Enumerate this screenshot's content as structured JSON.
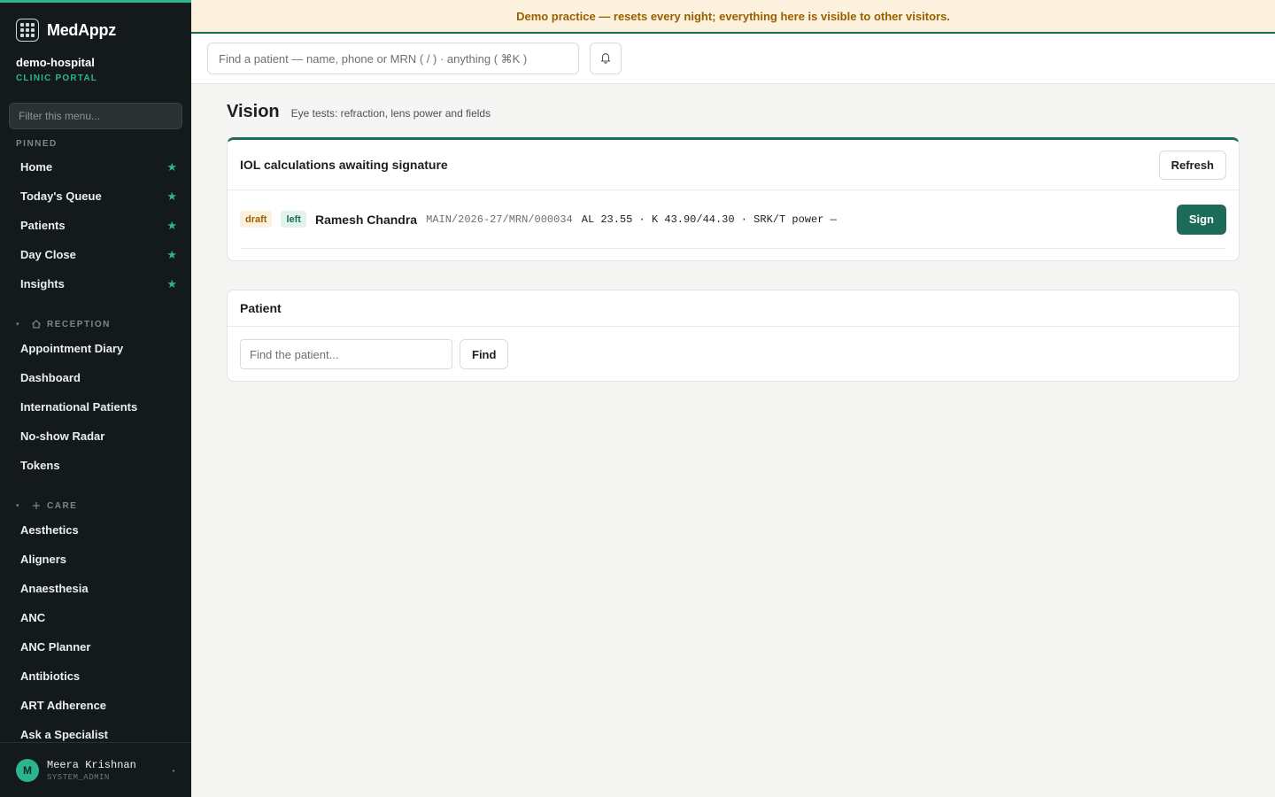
{
  "brand": {
    "name": "MedAppz"
  },
  "org": {
    "name": "demo-hospital",
    "subtitle": "CLINIC PORTAL"
  },
  "sidebar": {
    "filter_placeholder": "Filter this menu...",
    "pinned_label": "PINNED",
    "pinned": [
      {
        "label": "Home"
      },
      {
        "label": "Today's Queue"
      },
      {
        "label": "Patients"
      },
      {
        "label": "Day Close"
      },
      {
        "label": "Insights"
      }
    ],
    "reception": {
      "label": "RECEPTION",
      "icon": "home-icon",
      "items": [
        {
          "label": "Appointment Diary"
        },
        {
          "label": "Dashboard"
        },
        {
          "label": "International Patients"
        },
        {
          "label": "No-show Radar"
        },
        {
          "label": "Tokens"
        }
      ]
    },
    "care": {
      "label": "CARE",
      "icon": "plus-icon",
      "items": [
        {
          "label": "Aesthetics"
        },
        {
          "label": "Aligners"
        },
        {
          "label": "Anaesthesia"
        },
        {
          "label": "ANC"
        },
        {
          "label": "ANC Planner"
        },
        {
          "label": "Antibiotics"
        },
        {
          "label": "ART Adherence"
        },
        {
          "label": "Ask a Specialist"
        }
      ]
    },
    "user": {
      "initial": "M",
      "name": "Meera Krishnan",
      "role": "SYSTEM_ADMIN"
    }
  },
  "banner": {
    "text": "Demo practice — resets every night; everything here is visible to other visitors."
  },
  "header": {
    "search_placeholder": "Find a patient — name, phone or MRN ( / ) · anything ( ⌘K )"
  },
  "page": {
    "title": "Vision",
    "description": "Eye tests: refraction, lens power and fields"
  },
  "iol_card": {
    "title": "IOL calculations awaiting signature",
    "refresh_label": "Refresh",
    "rows": [
      {
        "status": "draft",
        "eye": "left",
        "patient": "Ramesh Chandra",
        "mrn": "MAIN/2026-27/MRN/000034",
        "measurements": "AL 23.55 · K 43.90/44.30 · SRK/T power —",
        "sign_label": "Sign"
      }
    ]
  },
  "patient_card": {
    "title": "Patient",
    "input_placeholder": "Find the patient...",
    "find_label": "Find"
  },
  "colors": {
    "accent": "#2bb58f",
    "primary": "#1d6b59",
    "sidebar_bg": "#14191b",
    "banner_bg": "#fbf1dc",
    "banner_text": "#9a5e00"
  }
}
